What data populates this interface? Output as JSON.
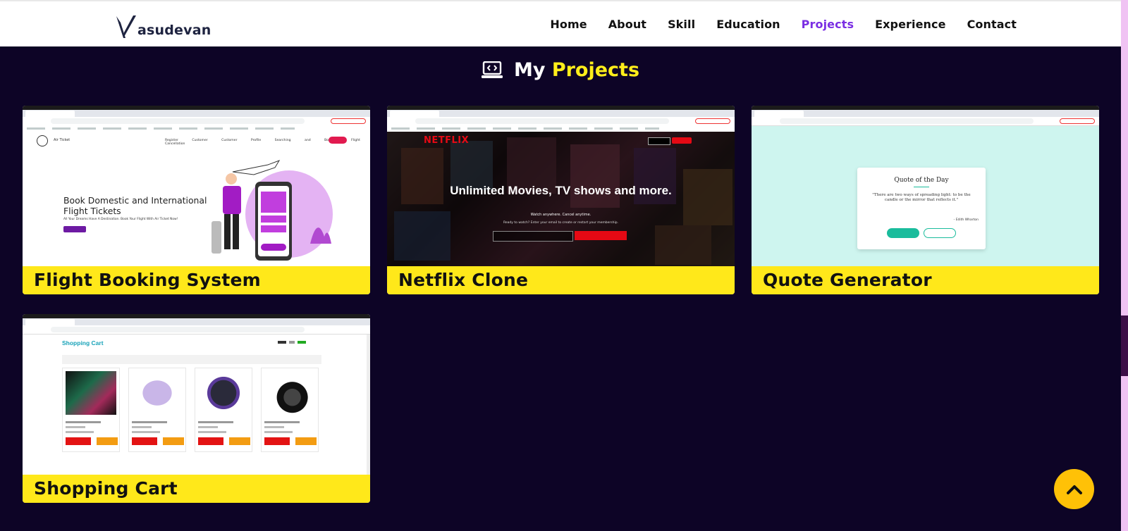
{
  "brand": {
    "logo_text": "asudevan"
  },
  "nav": {
    "items": [
      {
        "label": "Home",
        "active": false
      },
      {
        "label": "About",
        "active": false
      },
      {
        "label": "Skill",
        "active": false
      },
      {
        "label": "Education",
        "active": false
      },
      {
        "label": "Projects",
        "active": true
      },
      {
        "label": "Experience",
        "active": false
      },
      {
        "label": "Contact",
        "active": false
      }
    ]
  },
  "section": {
    "heading_prefix": "My",
    "heading_accent": "Projects",
    "icon": "laptop-code-icon"
  },
  "projects": [
    {
      "title": "Flight Booking System",
      "preview": {
        "brand": "Air Ticket",
        "links": "Register Customer Customer Profile Searching and Booking Flight Cancellation",
        "headline": "Book Domestic and International Flight Tickets",
        "sub": "All Your Dreams Have A Destination. Book Your Flight With Air Ticket Now!"
      }
    },
    {
      "title": "Netflix Clone",
      "preview": {
        "logo": "NETFLIX",
        "headline": "Unlimited Movies, TV shows and more.",
        "sub": "Watch anywhere. Cancel anytime.",
        "sub2": "Ready to watch? Enter your email to create or restart your membership."
      }
    },
    {
      "title": "Quote Generator",
      "preview": {
        "card_title": "Quote of the Day",
        "quote": "\"There are two ways of spreading light: to be the candle or the mirror that reflects it.\"",
        "author": "- Edith Wharton"
      }
    },
    {
      "title": "Shopping Cart",
      "preview": {
        "brand": "Shopping Cart"
      }
    }
  ],
  "colors": {
    "section_bg": "#0d0426",
    "accent_yellow": "#ffee1a",
    "nav_active": "#7a2ee3",
    "caption_bg": "#ffe81a",
    "to_top_bg": "#ffc107"
  },
  "to_top": {
    "icon": "chevron-up-icon"
  }
}
